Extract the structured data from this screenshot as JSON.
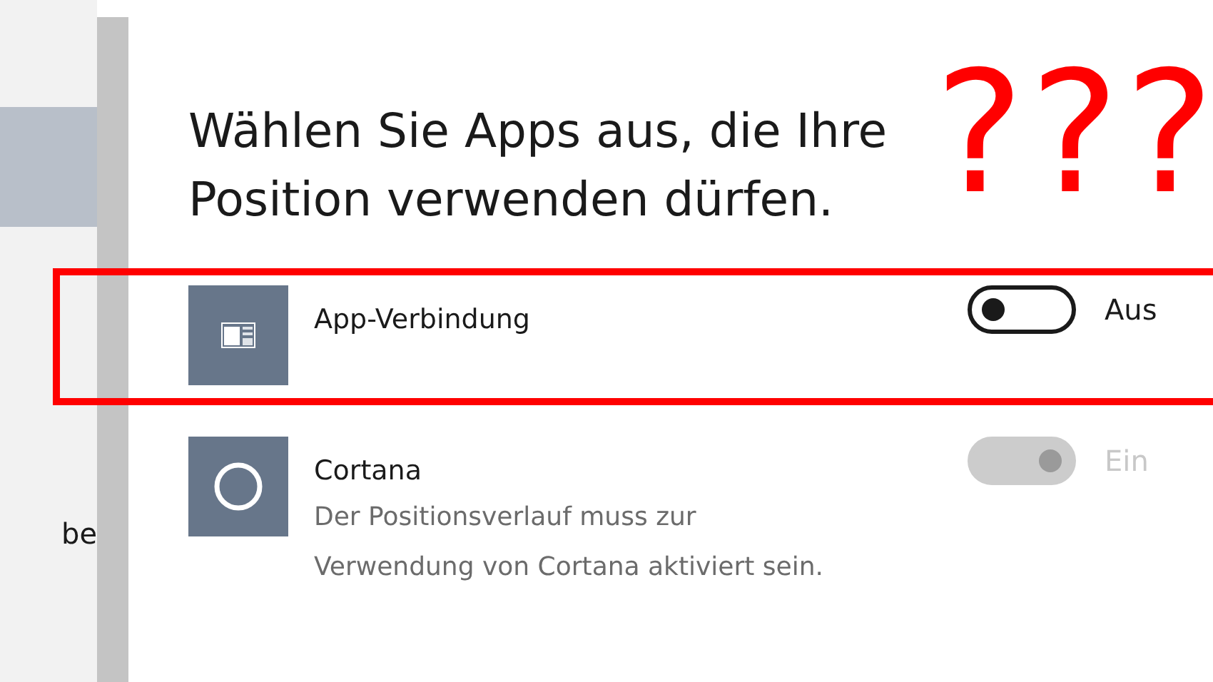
{
  "sidebar": {
    "items": [
      {
        "selected": true
      },
      {
        "label": "be",
        "selected": false
      }
    ]
  },
  "heading": "Wählen Sie Apps aus, die Ihre Position verwenden dürfen.",
  "apps": [
    {
      "kind": "window",
      "name": "App-Verbindung",
      "on": false,
      "disabled": false,
      "state_label": "Aus",
      "highlighted": true
    },
    {
      "kind": "circle",
      "name": "Cortana",
      "description": "Der Positionsverlauf muss zur Verwendung von Cortana aktiviert sein.",
      "on": true,
      "disabled": true,
      "state_label": "Ein",
      "highlighted": false
    }
  ],
  "annotation": {
    "marks": "???"
  }
}
